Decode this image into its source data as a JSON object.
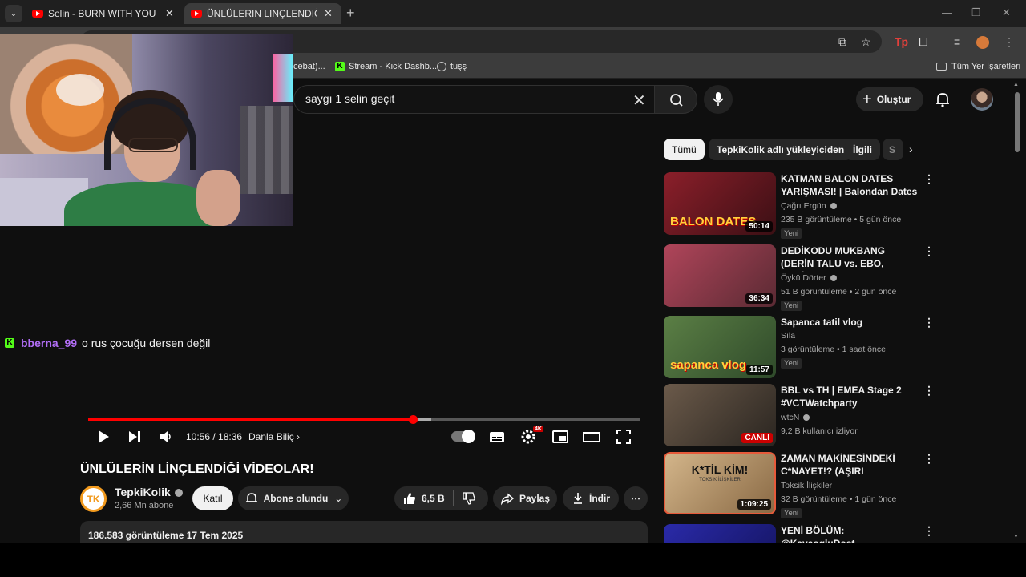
{
  "browser": {
    "tabs": [
      {
        "title": "Selin - BURN WITH YOU (Official"
      },
      {
        "title": "ÜNLÜLERIN LINÇLENDIĞI VIDEOLAR!"
      }
    ],
    "bookmarks": {
      "partial": "cebat)...",
      "kick": "Stream - Kick Dashb...",
      "tuss": "tuşş",
      "all": "Tüm Yer İşaretleri"
    }
  },
  "header": {
    "search_query": "saygı 1 selin geçit",
    "create_label": "Oluştur"
  },
  "chat": {
    "username": "bberna_99",
    "message": "o rus çocuğu dersen değil"
  },
  "player": {
    "time": "10:56 / 18:36",
    "chapter": "Danla Biliç",
    "progress": 0.588,
    "buffered": 0.622,
    "quality_badge": "4K"
  },
  "video": {
    "title": "ÜNLÜLERİN LİNÇLENDİĞİ VİDEOLAR!",
    "channel": "TepkiKolik",
    "channel_logo": "TK",
    "subscribers": "2,66 Mn abone",
    "join_label": "Katıl",
    "subscribed_label": "Abone olundu",
    "likes": "6,5 B",
    "share_label": "Paylaş",
    "download_label": "İndir",
    "views_date": "186.583 görüntüleme  17 Tem 2025"
  },
  "filters": [
    "Tümü",
    "TepkiKolik adlı yükleyiciden",
    "İlgili",
    "S"
  ],
  "recommendations": [
    {
      "title": "KATMAN BALON DATES YARIŞMASI! | Balondan Dates ...",
      "channel": "Çağrı Ergün",
      "verified": true,
      "meta": "235 B görüntüleme • 5 gün önce",
      "badge": "Yeni",
      "duration": "50:14",
      "thumb_text": "BALON DATES",
      "colors": [
        "#8b1f2a",
        "#3b0f14"
      ]
    },
    {
      "title": "DEDİKODU MUKBANG (DERİN TALU vs. EBO, HADİSE OLAY ...",
      "channel": "Öykü Dörter",
      "verified": true,
      "meta": "51 B görüntüleme • 2 gün önce",
      "badge": "Yeni",
      "duration": "36:34",
      "thumb_text": "",
      "colors": [
        "#b0455a",
        "#5a2a33"
      ]
    },
    {
      "title": "Sapanca tatil vlog",
      "channel": "Sıla",
      "verified": false,
      "meta": "3 görüntüleme • 1 saat önce",
      "badge": "Yeni",
      "duration": "11:57",
      "thumb_text": "sapanca vlog",
      "colors": [
        "#5b7f45",
        "#2f4a2a"
      ]
    },
    {
      "title": "BBL vs TH | EMEA Stage 2 #VCTWatchparty",
      "channel": "wtcN",
      "verified": true,
      "meta": "9,2 B kullanıcı izliyor",
      "badge": "",
      "duration": "CANLI",
      "thumb_text": "",
      "colors": [
        "#6b5a4a",
        "#2a2520"
      ]
    },
    {
      "title": "ZAMAN MAKİNESİNDEKİ C*NAYET!? (AŞIRI ZORLANDIK...",
      "channel": "Toksik İlişkiler",
      "verified": false,
      "meta": "32 B görüntüleme • 1 gün önce",
      "badge": "Yeni",
      "duration": "1:09:25",
      "thumb_text": "K*TİL KİM!",
      "thumb_sub": "TOKSİK İLİŞKİLER",
      "colors": [
        "#d3b58a",
        "#8a6a45"
      ]
    },
    {
      "title": "YENİ BÖLÜM: @KayaogluDost, @Cenapolsum VS ...",
      "channel": "",
      "verified": false,
      "meta": "",
      "badge": "",
      "duration": "",
      "thumb_text": "",
      "colors": [
        "#2a2aa8",
        "#12125a"
      ]
    }
  ]
}
